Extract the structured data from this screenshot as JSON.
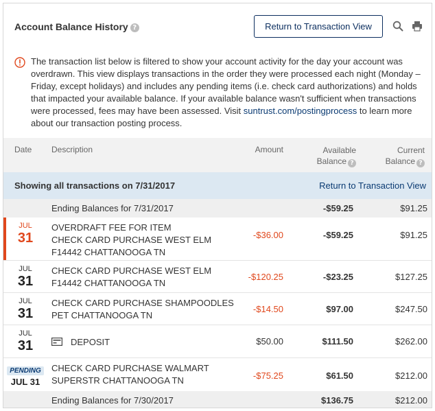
{
  "header": {
    "title": "Account Balance History",
    "help_icon": "question-circle-icon",
    "return_button": "Return to Transaction View",
    "search_icon": "search-icon",
    "print_icon": "print-icon"
  },
  "notice": {
    "icon": "info-circle-icon",
    "icon_color": "#e0471c",
    "text_before": "The transaction list below is filtered to show your account activity for the day your account was overdrawn. This view displays transactions in the order they were processed each night (Monday – Friday, except holidays) and includes any pending items (i.e. check card authorizations) and holds that impacted your available balance.  If your available balance wasn't sufficient when transactions were processed, fees may have been assessed. Visit ",
    "link_text": "suntrust.com/postingprocess",
    "text_after": " to learn more about our transaction posting process."
  },
  "table": {
    "columns": {
      "date": "Date",
      "description": "Description",
      "amount": "Amount",
      "available_1": "Available",
      "available_2": "Balance",
      "current_1": "Current",
      "current_2": "Balance"
    },
    "showing": {
      "text": "Showing all transactions on 7/31/2017",
      "link": "Return to Transaction View"
    },
    "ending_top": {
      "label": "Ending Balances for 7/31/2017",
      "available": "-$59.25",
      "current": "$91.25"
    },
    "rows": [
      {
        "month": "JUL",
        "day": "31",
        "lines": [
          "OVERDRAFT FEE FOR ITEM",
          "CHECK CARD PURCHASE WEST ELM",
          "F14442 CHATTANOOGA TN"
        ],
        "amount": "-$36.00",
        "available": "-$59.25",
        "current": "$91.25"
      },
      {
        "month": "JUL",
        "day": "31",
        "lines": [
          "CHECK CARD PURCHASE WEST ELM",
          "F14442 CHATTANOOGA TN"
        ],
        "amount": "-$120.25",
        "available": "-$23.25",
        "current": "$127.25"
      },
      {
        "month": "JUL",
        "day": "31",
        "lines": [
          "CHECK CARD PURCHASE SHAMPOODLES",
          "PET CHATTANOOGA TN"
        ],
        "amount": "-$14.50",
        "available": "$97.00",
        "current": "$247.50"
      },
      {
        "month": "JUL",
        "day": "31",
        "icon": "deposit-icon",
        "lines": [
          "DEPOSIT"
        ],
        "amount": "$50.00",
        "available": "$111.50",
        "current": "$262.00"
      },
      {
        "badge": "PENDING",
        "date": "JUL 31",
        "lines": [
          "CHECK CARD PURCHASE WALMART",
          "SUPERSTR CHATTANOOGA TN"
        ],
        "amount": "-$75.25",
        "available": "$61.50",
        "current": "$212.00"
      }
    ],
    "ending_bottom": {
      "label": "Ending Balances for 7/30/2017",
      "available": "$136.75",
      "current": "$212.00"
    }
  },
  "colors": {
    "negative": "#e0471c",
    "link": "#0a3a72",
    "button_border": "#0a2d5e",
    "showing_bar": "#dce8f2"
  }
}
